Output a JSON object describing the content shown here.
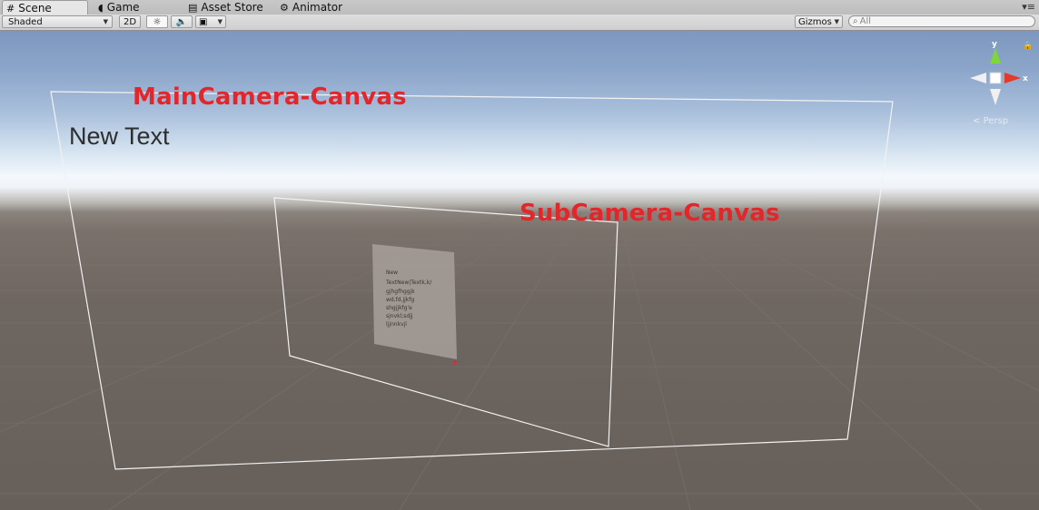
{
  "tabs": [
    {
      "label": "Scene",
      "icon": "grid-icon",
      "active": true
    },
    {
      "label": "Game",
      "icon": "pacman-icon",
      "active": false
    },
    {
      "label": "Asset Store",
      "icon": "store-icon",
      "active": false
    },
    {
      "label": "Animator",
      "icon": "animator-icon",
      "active": false
    }
  ],
  "toolbar": {
    "draw_mode": "Shaded",
    "mode_2d": "2D",
    "gizmos": "Gizmos",
    "search_placeholder": "All"
  },
  "scene": {
    "main_label": "MainCamera-Canvas",
    "sub_label": "SubCamera-Canvas",
    "new_text": "New Text",
    "panel_text_lines": [
      "New",
      "TextNew|Textk,k/",
      "gjhgfhggjk",
      "wd,fd,jjkfg",
      "shgjjkfg'e",
      "sjnvkl;sdjj",
      "ljjnnkvjl"
    ],
    "axes": {
      "y": "y",
      "x": "x"
    },
    "projection": "Persp"
  },
  "colors": {
    "label_red": "#e3262a",
    "gizmo_y": "#7fd63a",
    "gizmo_x": "#e23b2e"
  }
}
